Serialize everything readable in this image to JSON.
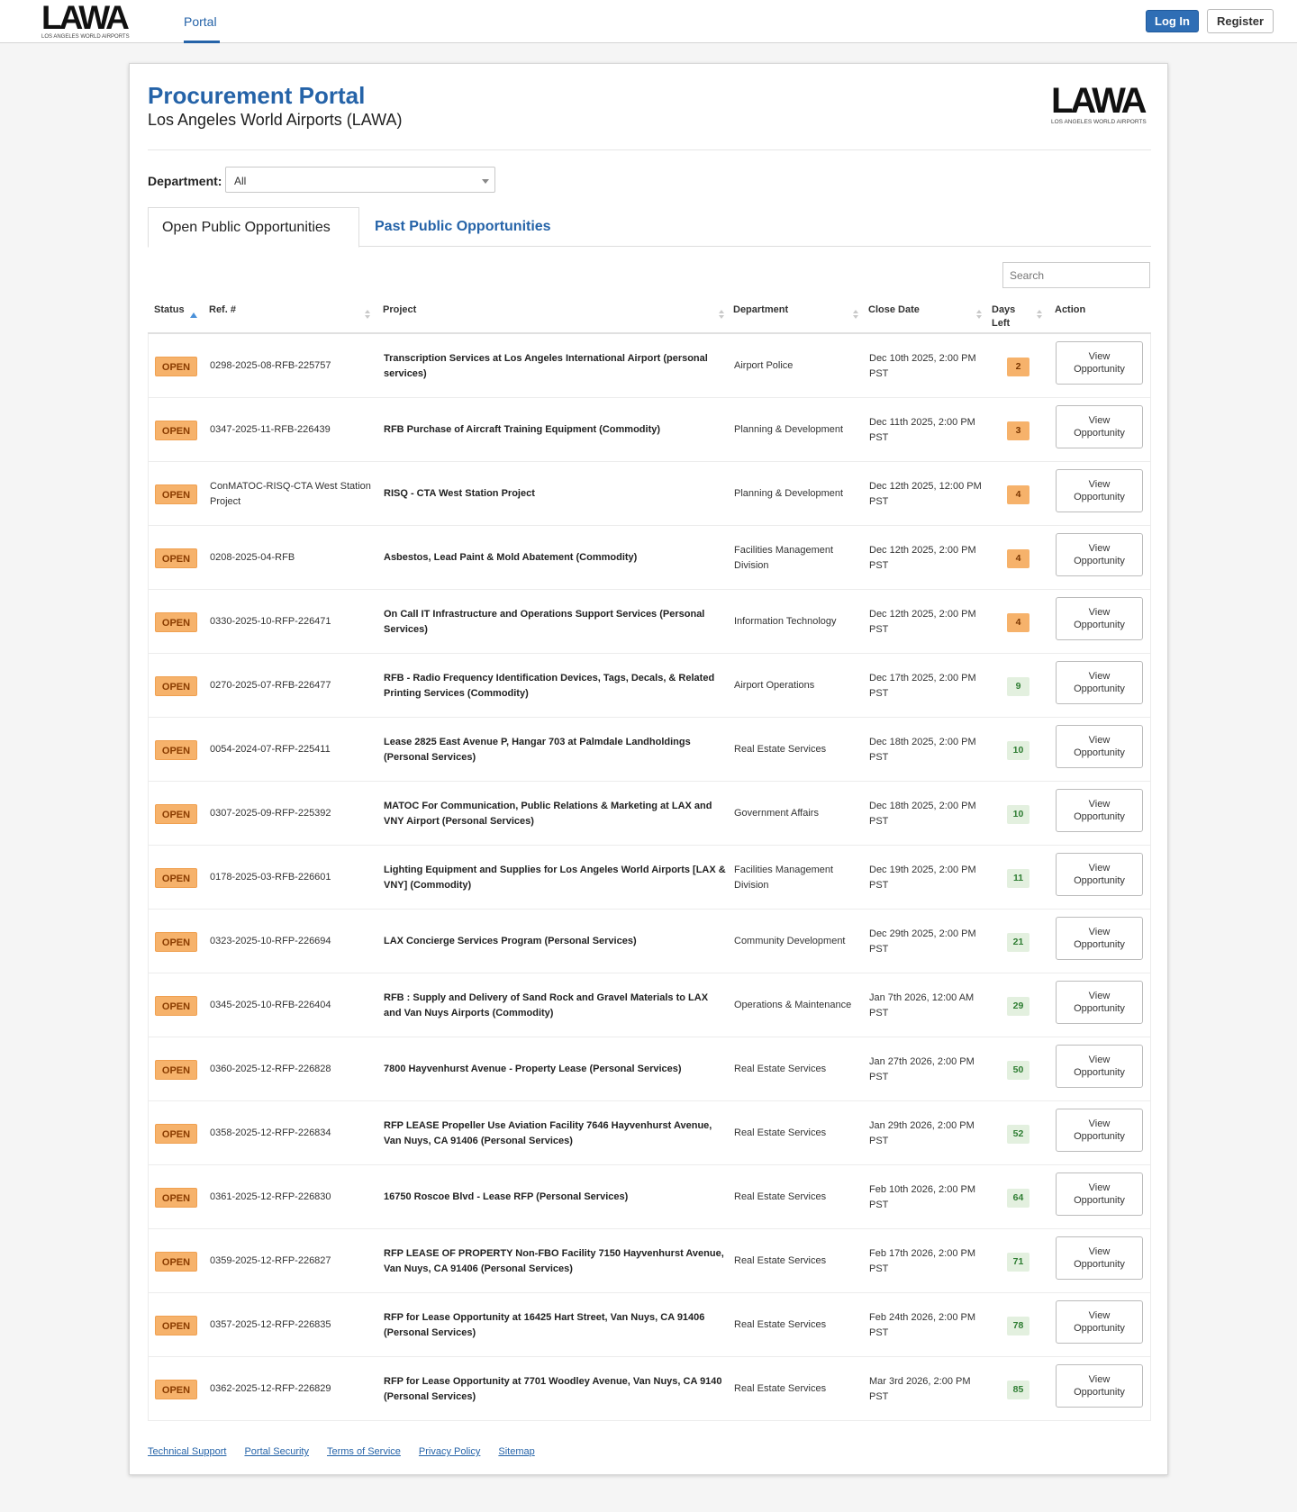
{
  "header": {
    "logo_word": "LAWA",
    "logo_tagline": "LOS ANGELES WORLD AIRPORTS",
    "nav_tab": "Portal",
    "login_label": "Log In",
    "register_label": "Register"
  },
  "page": {
    "title": "Procurement Portal",
    "subtitle": "Los Angeles World Airports (LAWA)",
    "department_label": "Department:",
    "department_value": "All",
    "tab_open": "Open Public Opportunities",
    "tab_past": "Past Public Opportunities",
    "search_placeholder": "Search"
  },
  "table": {
    "columns": {
      "status": "Status",
      "ref": "Ref. #",
      "project": "Project",
      "department": "Department",
      "close_date": "Close Date",
      "days_left": "Days Left",
      "action": "Action"
    },
    "status_label": "OPEN",
    "action_label": "View Opportunity",
    "rows": [
      {
        "ref": "0298-2025-08-RFB-225757",
        "project": "Transcription Services at Los Angeles International Airport (personal services)",
        "department": "Airport Police",
        "close": "Dec 10th 2025, 2:00 PM PST",
        "days": "2",
        "level": "warn"
      },
      {
        "ref": "0347-2025-11-RFB-226439",
        "project": "RFB Purchase of Aircraft Training Equipment (Commodity)",
        "department": "Planning & Development",
        "close": "Dec 11th 2025, 2:00 PM PST",
        "days": "3",
        "level": "warn"
      },
      {
        "ref": "ConMATOC-RISQ-CTA West Station Project",
        "project": "RISQ - CTA West Station Project",
        "department": "Planning & Development",
        "close": "Dec 12th 2025, 12:00 PM PST",
        "days": "4",
        "level": "warn"
      },
      {
        "ref": "0208-2025-04-RFB",
        "project": "Asbestos, Lead Paint & Mold Abatement (Commodity)",
        "department": "Facilities Management Division",
        "close": "Dec 12th 2025, 2:00 PM PST",
        "days": "4",
        "level": "warn"
      },
      {
        "ref": "0330-2025-10-RFP-226471",
        "project": "On Call IT Infrastructure and Operations Support Services (Personal Services)",
        "department": "Information Technology",
        "close": "Dec 12th 2025, 2:00 PM PST",
        "days": "4",
        "level": "warn"
      },
      {
        "ref": "0270-2025-07-RFB-226477",
        "project": "RFB - Radio Frequency Identification Devices, Tags, Decals, & Related Printing Services (Commodity)",
        "department": "Airport Operations",
        "close": "Dec 17th 2025, 2:00 PM PST",
        "days": "9",
        "level": "ok"
      },
      {
        "ref": "0054-2024-07-RFP-225411",
        "project": "Lease 2825 East Avenue P, Hangar 703 at Palmdale Landholdings (Personal Services)",
        "department": "Real Estate Services",
        "close": "Dec 18th 2025, 2:00 PM PST",
        "days": "10",
        "level": "ok"
      },
      {
        "ref": "0307-2025-09-RFP-225392",
        "project": "MATOC For Communication, Public Relations & Marketing at LAX and VNY Airport (Personal Services)",
        "department": "Government Affairs",
        "close": "Dec 18th 2025, 2:00 PM PST",
        "days": "10",
        "level": "ok"
      },
      {
        "ref": "0178-2025-03-RFB-226601",
        "project": "Lighting Equipment and Supplies for Los Angeles World Airports [LAX & VNY] (Commodity)",
        "department": "Facilities Management Division",
        "close": "Dec 19th 2025, 2:00 PM PST",
        "days": "11",
        "level": "ok"
      },
      {
        "ref": "0323-2025-10-RFP-226694",
        "project": "LAX Concierge Services Program (Personal Services)",
        "department": "Community Development",
        "close": "Dec 29th 2025, 2:00 PM PST",
        "days": "21",
        "level": "ok"
      },
      {
        "ref": "0345-2025-10-RFB-226404",
        "project": "RFB : Supply and Delivery of Sand Rock and Gravel Materials to LAX and Van Nuys Airports (Commodity)",
        "department": "Operations & Maintenance",
        "close": "Jan 7th 2026, 12:00 AM PST",
        "days": "29",
        "level": "ok"
      },
      {
        "ref": "0360-2025-12-RFP-226828",
        "project": "7800 Hayvenhurst Avenue - Property Lease (Personal Services)",
        "department": "Real Estate Services",
        "close": "Jan 27th 2026, 2:00 PM PST",
        "days": "50",
        "level": "ok"
      },
      {
        "ref": "0358-2025-12-RFP-226834",
        "project": "RFP LEASE Propeller Use Aviation Facility 7646 Hayvenhurst Avenue, Van Nuys, CA 91406 (Personal Services)",
        "department": "Real Estate Services",
        "close": "Jan 29th 2026, 2:00 PM PST",
        "days": "52",
        "level": "ok"
      },
      {
        "ref": "0361-2025-12-RFP-226830",
        "project": "16750 Roscoe Blvd - Lease RFP (Personal Services)",
        "department": "Real Estate Services",
        "close": "Feb 10th 2026, 2:00 PM PST",
        "days": "64",
        "level": "ok"
      },
      {
        "ref": "0359-2025-12-RFP-226827",
        "project": "RFP LEASE OF PROPERTY Non-FBO Facility 7150 Hayvenhurst Avenue, Van Nuys, CA 91406 (Personal Services)",
        "department": "Real Estate Services",
        "close": "Feb 17th 2026, 2:00 PM PST",
        "days": "71",
        "level": "ok"
      },
      {
        "ref": "0357-2025-12-RFP-226835",
        "project": "RFP for Lease Opportunity at 16425 Hart Street, Van Nuys, CA 91406 (Personal Services)",
        "department": "Real Estate Services",
        "close": "Feb 24th 2026, 2:00 PM PST",
        "days": "78",
        "level": "ok"
      },
      {
        "ref": "0362-2025-12-RFP-226829",
        "project": "RFP for Lease Opportunity at 7701 Woodley Avenue, Van Nuys, CA 9140 (Personal Services)",
        "department": "Real Estate Services",
        "close": "Mar 3rd 2026, 2:00 PM PST",
        "days": "85",
        "level": "ok"
      }
    ]
  },
  "footer": {
    "links": [
      "Technical Support",
      "Portal Security",
      "Terms of Service",
      "Privacy Policy",
      "Sitemap"
    ]
  }
}
